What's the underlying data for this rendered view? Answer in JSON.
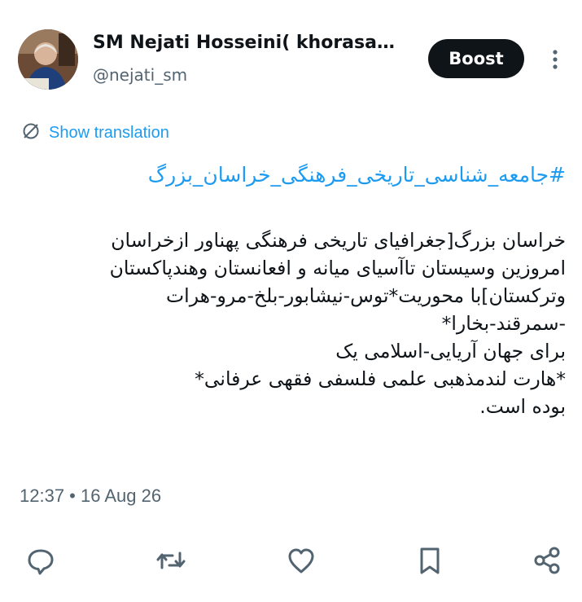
{
  "author": {
    "display_name": "SM Nejati Hosseini( khorasan...",
    "handle": "@nejati_sm"
  },
  "boost_label": "Boost",
  "translate_label": "Show translation",
  "hashtag": "#جامعه_شناسی_تاریخی_فرهنگی_خراسان_بزرگ",
  "body_lines": [
    "خراسان بزرگ[جغرافیای تاریخی فرهنگی پهناور ازخراسان",
    "امروزین وسیستان تاآسیای میانه و افعانستان وهندپاکستان",
    "وترکستان]با محوریت*توس-نیشابور-بلخ-مرو-هرات",
    "-سمرقند-بخارا*",
    "برای جهان آریایی-اسلامی یک",
    "*هارت لندمذهبی علمی فلسفی فقهی عرفانی*",
    "بوده است."
  ],
  "timestamp": "12:37 • 16 Aug 26",
  "icons": {
    "more": "more-vertical-icon",
    "translate": "translate-icon",
    "reply": "reply-icon",
    "retweet": "retweet-icon",
    "like": "like-icon",
    "bookmark": "bookmark-icon",
    "share": "share-icon"
  },
  "colors": {
    "link": "#1d9bf0",
    "muted": "#536471",
    "text": "#0f1419",
    "boost_bg": "#0f1419"
  }
}
